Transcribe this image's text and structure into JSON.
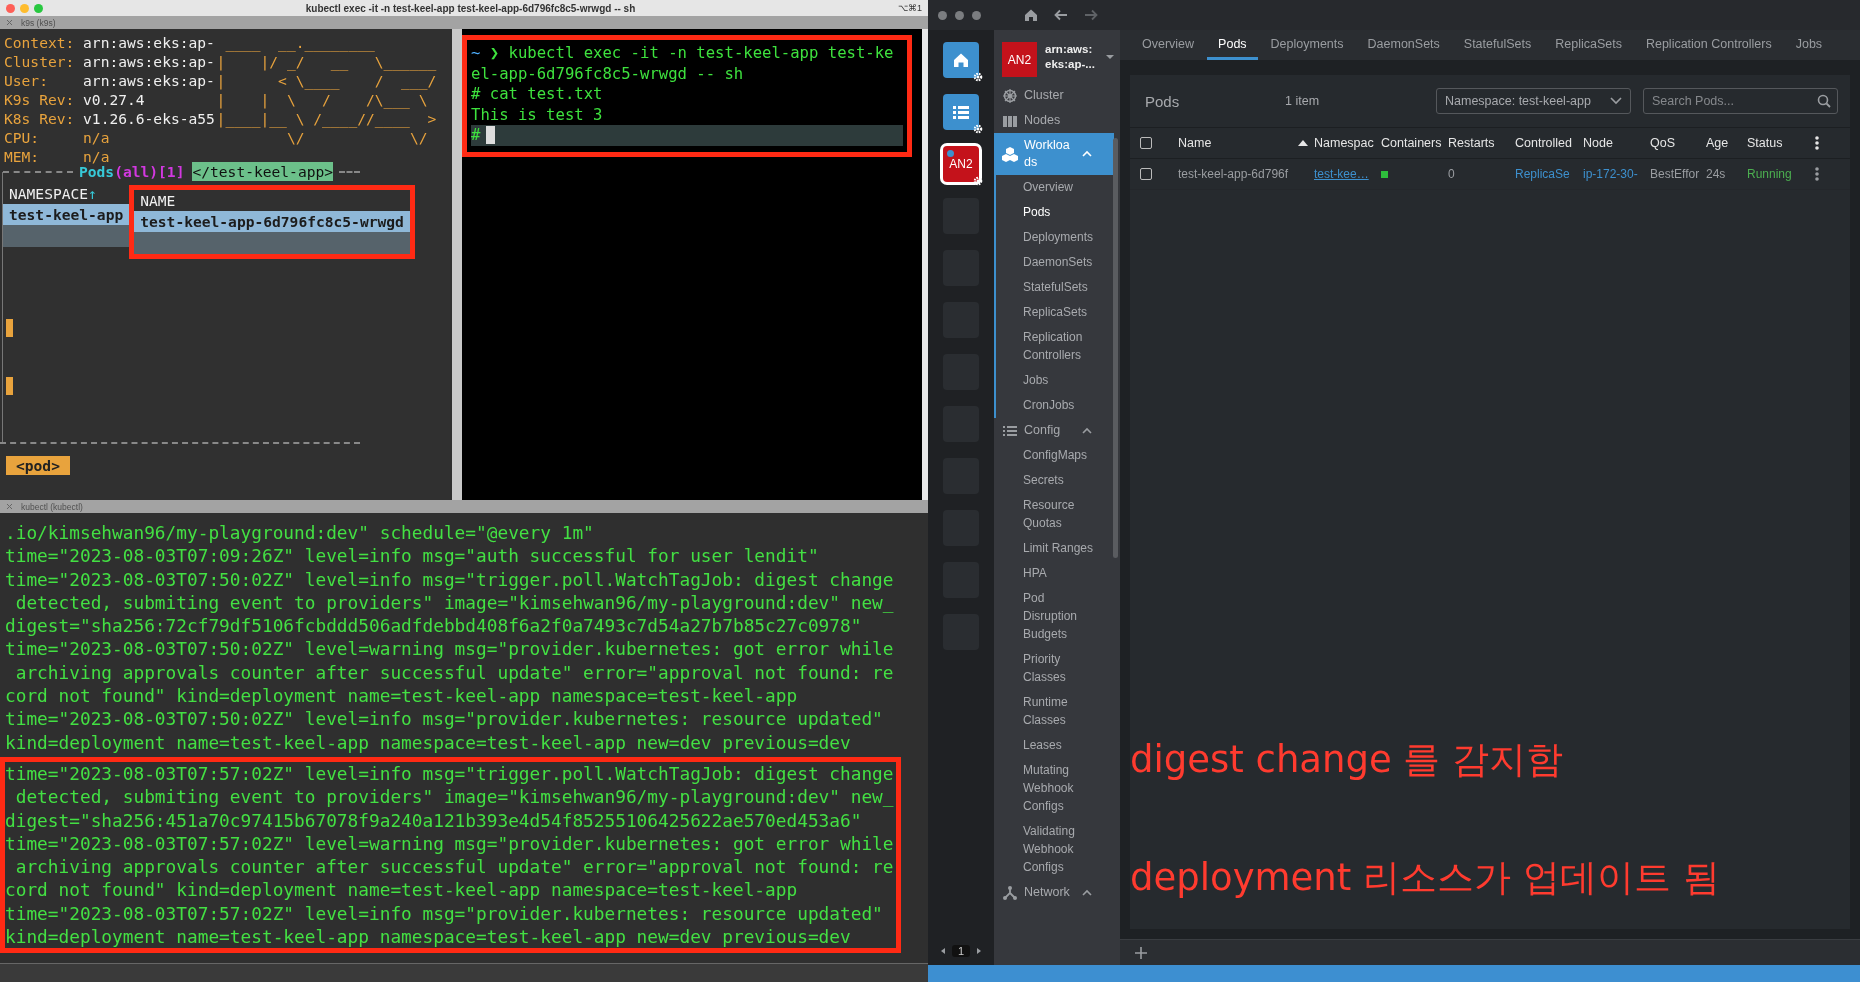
{
  "terminal": {
    "title": "kubectl exec -it -n test-keel-app test-keel-app-6d796fc8c5-wrwgd -- sh",
    "shortcut": "⌥⌘1",
    "top_tab": "k9s (k9s)",
    "k9s": {
      "info": [
        {
          "label": "Context:",
          "value": "arn:aws:eks:ap-",
          "kind": "text"
        },
        {
          "label": "Cluster:",
          "value": "arn:aws:eks:ap-",
          "kind": "text"
        },
        {
          "label": "User:",
          "value": "arn:aws:eks:ap-",
          "kind": "text"
        },
        {
          "label": "K9s Rev:",
          "value": "v0.27.4",
          "kind": "text"
        },
        {
          "label": "K8s Rev:",
          "value": "v1.26.6-eks-a55",
          "kind": "text"
        },
        {
          "label": "CPU:",
          "value": "n/a",
          "kind": "metric"
        },
        {
          "label": "MEM:",
          "value": "n/a",
          "kind": "metric"
        }
      ],
      "logo": [
        " ____  __.________",
        "|    |/ _/   __   \\______",
        "|      < \\____    /  ___/",
        "|    |  \\   /    /\\___ \\",
        "|____|__ \\ /____//____  >",
        "        \\/            \\/"
      ],
      "table": {
        "title": "Pods",
        "scope": "(all)[1]",
        "filter": "</test-keel-app>",
        "columns": [
          {
            "label": "NAMESPACE",
            "sort_mark": "↑",
            "highlighted": false
          },
          {
            "label": "NAME",
            "highlighted": true
          }
        ],
        "rows": [
          {
            "selected": true,
            "cells": [
              "test-keel-app",
              "test-keel-app-6d796fc8c5-wrwgd"
            ]
          }
        ]
      },
      "crumb": "<pod>"
    },
    "shell": {
      "highlighted": true,
      "lines": [
        {
          "kind": "command",
          "cwd": "~",
          "prompt": "❯",
          "text": "kubectl exec -it -n test-keel-app test-keel-app-6d796fc8c5-wrwgd -- sh"
        },
        {
          "kind": "output",
          "text": "# cat test.txt"
        },
        {
          "kind": "output",
          "text": "This is test 3"
        },
        {
          "kind": "input",
          "prompt": "#"
        }
      ]
    },
    "bottom_tab": "kubectl (kubectl)",
    "log_blocks": [
      {
        "highlighted": false,
        "lines": [
          ".io/kimsehwan96/my-playground:dev\" schedule=\"@every 1m\"",
          "time=\"2023-08-03T07:09:26Z\" level=info msg=\"auth successful for user lendit\"",
          "time=\"2023-08-03T07:50:02Z\" level=info msg=\"trigger.poll.WatchTagJob: digest change",
          " detected, submiting event to providers\" image=\"kimsehwan96/my-playground:dev\" new_",
          "digest=\"sha256:72cf79df5106fcbddd506adfdebbd408f6a2f0a7493c7d54a27b7b85c27c0978\"",
          "time=\"2023-08-03T07:50:02Z\" level=warning msg=\"provider.kubernetes: got error while",
          " archiving approvals counter after successful update\" error=\"approval not found: re",
          "cord not found\" kind=deployment name=test-keel-app namespace=test-keel-app",
          "time=\"2023-08-03T07:50:02Z\" level=info msg=\"provider.kubernetes: resource updated\"",
          "kind=deployment name=test-keel-app namespace=test-keel-app new=dev previous=dev"
        ]
      },
      {
        "highlighted": true,
        "lines": [
          "time=\"2023-08-03T07:57:02Z\" level=info msg=\"trigger.poll.WatchTagJob: digest change",
          " detected, submiting event to providers\" image=\"kimsehwan96/my-playground:dev\" new_",
          "digest=\"sha256:451a70c97415b67078f9a240a121b393e4d54f85255106425622ae570ed453a6\"",
          "time=\"2023-08-03T07:57:02Z\" level=warning msg=\"provider.kubernetes: got error while",
          " archiving approvals counter after successful update\" error=\"approval not found: re",
          "cord not found\" kind=deployment name=test-keel-app namespace=test-keel-app",
          "time=\"2023-08-03T07:57:02Z\" level=info msg=\"provider.kubernetes: resource updated\"",
          "kind=deployment name=test-keel-app namespace=test-keel-app new=dev previous=dev"
        ]
      }
    ]
  },
  "lens": {
    "hotbar": [
      {
        "kind": "home",
        "selected": false
      },
      {
        "kind": "list",
        "selected": false
      },
      {
        "kind": "cluster",
        "label": "AN2",
        "selected": true
      },
      {
        "kind": "empty",
        "selected": false
      },
      {
        "kind": "empty",
        "selected": false
      },
      {
        "kind": "empty",
        "selected": false
      },
      {
        "kind": "empty",
        "selected": false
      },
      {
        "kind": "empty",
        "selected": false
      },
      {
        "kind": "empty",
        "selected": false
      },
      {
        "kind": "empty",
        "selected": false
      },
      {
        "kind": "empty",
        "selected": false
      },
      {
        "kind": "empty",
        "selected": false
      }
    ],
    "hotbar_page": "1",
    "cluster": {
      "badge": "AN2",
      "name": "arn:aws:eks:ap-..."
    },
    "sidebar": [
      {
        "label": "Cluster",
        "kind": "cluster",
        "selected": false
      },
      {
        "label": "Nodes",
        "kind": "nodes",
        "selected": false
      },
      {
        "label": "Workloads",
        "kind": "workloads",
        "selected": true,
        "expanded": true,
        "children": [
          {
            "label": "Overview",
            "selected": false
          },
          {
            "label": "Pods",
            "selected": true
          },
          {
            "label": "Deployments",
            "selected": false
          },
          {
            "label": "DaemonSets",
            "selected": false
          },
          {
            "label": "StatefulSets",
            "selected": false
          },
          {
            "label": "ReplicaSets",
            "selected": false
          },
          {
            "label": "Replication Controllers",
            "selected": false
          },
          {
            "label": "Jobs",
            "selected": false
          },
          {
            "label": "CronJobs",
            "selected": false
          }
        ]
      },
      {
        "label": "Config",
        "kind": "config",
        "selected": false,
        "expanded": true,
        "children": [
          {
            "label": "ConfigMaps",
            "selected": false
          },
          {
            "label": "Secrets",
            "selected": false
          },
          {
            "label": "Resource Quotas",
            "selected": false
          },
          {
            "label": "Limit Ranges",
            "selected": false
          },
          {
            "label": "HPA",
            "selected": false
          },
          {
            "label": "Pod Disruption Budgets",
            "selected": false
          },
          {
            "label": "Priority Classes",
            "selected": false
          },
          {
            "label": "Runtime Classes",
            "selected": false
          },
          {
            "label": "Leases",
            "selected": false
          },
          {
            "label": "Mutating Webhook Configs",
            "selected": false
          },
          {
            "label": "Validating Webhook Configs",
            "selected": false
          }
        ]
      },
      {
        "label": "Network",
        "kind": "network",
        "selected": false,
        "expanded": true
      }
    ],
    "tabs": [
      {
        "label": "Overview",
        "selected": false
      },
      {
        "label": "Pods",
        "selected": true
      },
      {
        "label": "Deployments",
        "selected": false
      },
      {
        "label": "DaemonSets",
        "selected": false
      },
      {
        "label": "StatefulSets",
        "selected": false
      },
      {
        "label": "ReplicaSets",
        "selected": false
      },
      {
        "label": "Replication Controllers",
        "selected": false
      },
      {
        "label": "Jobs",
        "selected": false
      }
    ],
    "panel": {
      "select_all": {
        "checked": false
      },
      "title": "Pods",
      "count": "1 item",
      "namespace_select": "Namespace: test-keel-app",
      "search": {
        "placeholder": "Search Pods..."
      },
      "columns": [
        {
          "label": "Name",
          "sorted": true
        },
        {
          "label": "Namespac"
        },
        {
          "label": "Containers"
        },
        {
          "label": "Restarts"
        },
        {
          "label": "Controlled"
        },
        {
          "label": "Node"
        },
        {
          "label": "QoS"
        },
        {
          "label": "Age"
        },
        {
          "label": "Status"
        }
      ],
      "rows": [
        {
          "checked": false,
          "cells": [
            {
              "kind": "text",
              "text": "test-keel-app-6d796f"
            },
            {
              "kind": "link",
              "text": "test-kee…"
            },
            {
              "kind": "dot",
              "color": "#2ebd3c"
            },
            {
              "kind": "text",
              "text": "0"
            },
            {
              "kind": "ref",
              "text": "ReplicaSe"
            },
            {
              "kind": "ref",
              "text": "ip-172-30-"
            },
            {
              "kind": "text",
              "text": "BestEffor"
            },
            {
              "kind": "text",
              "text": "24s"
            },
            {
              "kind": "status",
              "text": "Running",
              "color": "#4caf50"
            }
          ]
        }
      ]
    }
  },
  "annotations": [
    "digest change 를 감지함",
    "deployment 리소스가 업데이트 됨"
  ]
}
